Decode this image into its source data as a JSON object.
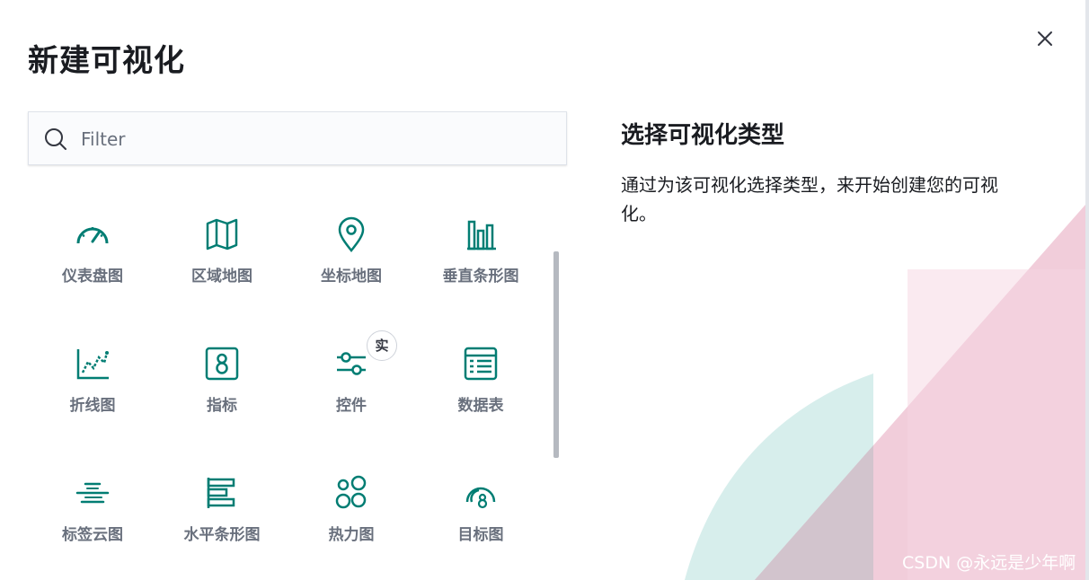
{
  "modal": {
    "title": "新建可视化",
    "close_icon": "close-icon"
  },
  "search": {
    "placeholder": "Filter",
    "value": "",
    "icon": "search-icon"
  },
  "visualizations": [
    {
      "label": "仪表盘图",
      "icon": "gauge-icon"
    },
    {
      "label": "区域地图",
      "icon": "map-icon"
    },
    {
      "label": "坐标地图",
      "icon": "map-pin-icon"
    },
    {
      "label": "垂直条形图",
      "icon": "vertical-bar-chart-icon"
    },
    {
      "label": "折线图",
      "icon": "line-chart-icon"
    },
    {
      "label": "指标",
      "icon": "metric-icon"
    },
    {
      "label": "控件",
      "icon": "controls-icon",
      "badge": "实"
    },
    {
      "label": "数据表",
      "icon": "table-icon"
    },
    {
      "label": "标签云图",
      "icon": "tag-cloud-icon"
    },
    {
      "label": "水平条形图",
      "icon": "horizontal-bar-chart-icon"
    },
    {
      "label": "热力图",
      "icon": "heatmap-icon"
    },
    {
      "label": "目标图",
      "icon": "goal-icon"
    }
  ],
  "panel": {
    "title": "选择可视化类型",
    "description": "通过为该可视化选择类型，来开始创建您的可视化。"
  },
  "watermark": "CSDN @永远是少年啊",
  "colors": {
    "accent": "#017d73",
    "label_gray": "#69707d",
    "text": "#1a1c21",
    "deco_teal": "#bfe3e0",
    "deco_pink": "#f0bcd0"
  }
}
